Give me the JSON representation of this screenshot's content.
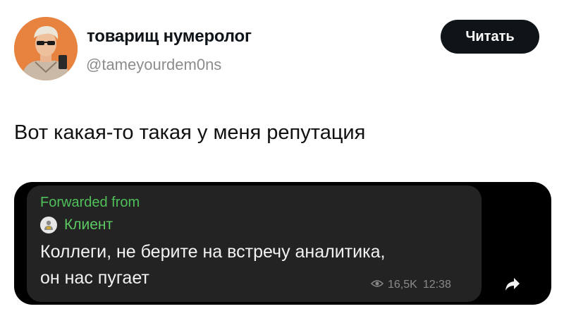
{
  "profile": {
    "display_name": "товарищ нумеролог",
    "handle": "@tameyourdem0ns",
    "avatar_icon": "person-with-sunglasses-avatar",
    "avatar_bg": "#e8823f"
  },
  "follow_button": {
    "label": "Читать",
    "color": "#0f1419"
  },
  "tweet": {
    "text": "Вот какая-то такая у меня репутация"
  },
  "telegram_message": {
    "forwarded_label": "Forwarded from",
    "sender_name": "Клиент",
    "sender_icon": "user-avatar-icon",
    "text_line1": "Коллеги, не берите на встречу аналитика,",
    "text_line2": "он нас пугает",
    "views": "16,5K",
    "time": "12:38",
    "views_icon": "eye-icon",
    "share_icon": "share-arrow-icon",
    "accent_color": "#4fbf5a"
  }
}
